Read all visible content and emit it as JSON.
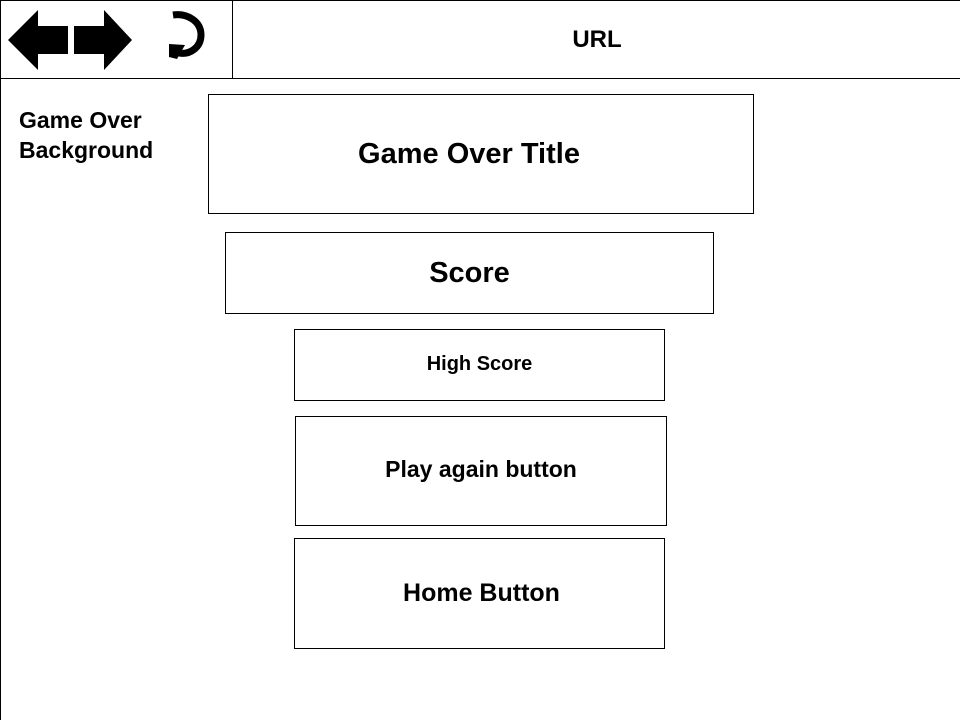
{
  "browser": {
    "url_label": "URL",
    "icons": {
      "back": "back-arrow-icon",
      "forward": "forward-arrow-icon",
      "refresh": "refresh-icon"
    }
  },
  "page": {
    "background_label": "Game Over Background",
    "title": "Game Over Title",
    "score": "Score",
    "high_score": "High Score",
    "play_again": "Play again button",
    "home": "Home Button"
  }
}
